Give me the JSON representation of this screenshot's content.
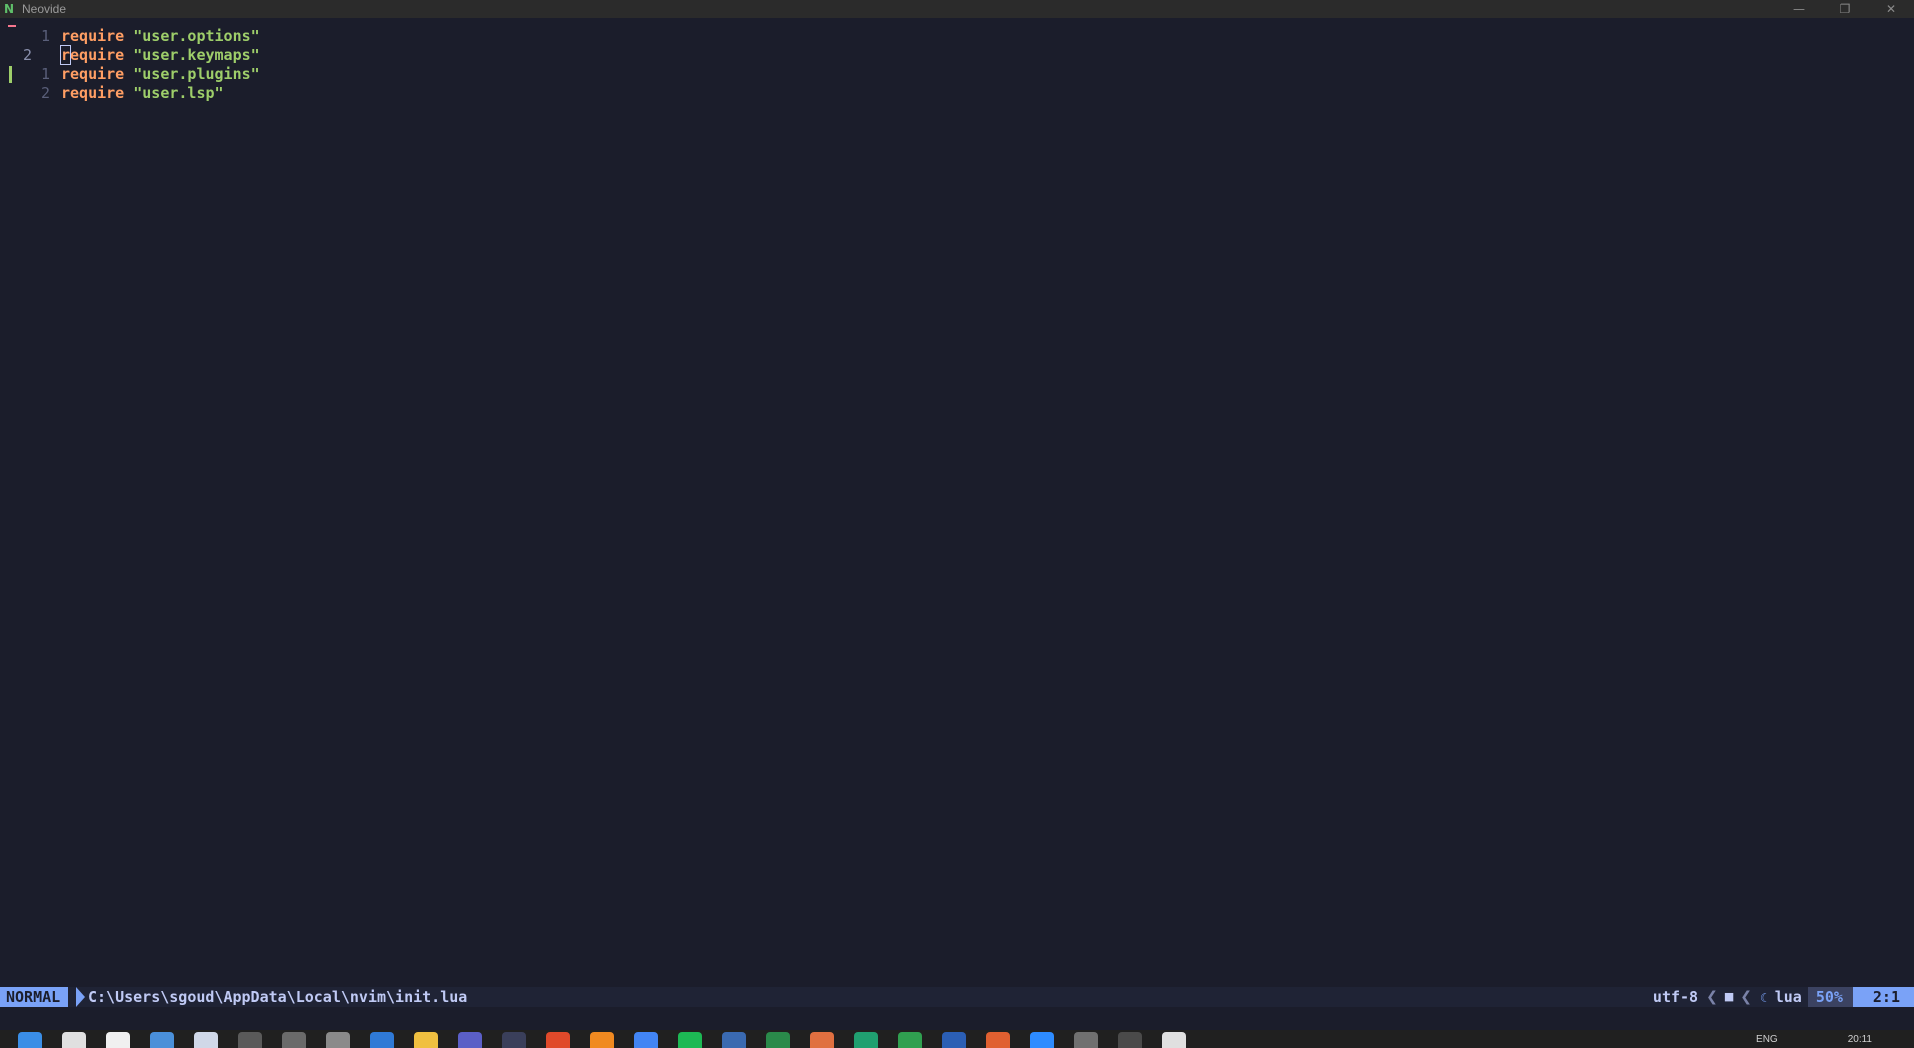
{
  "window": {
    "title": "Neovide",
    "logo_glyph": "N",
    "controls": {
      "minimize": "—",
      "maximize": "❐",
      "close": "✕"
    }
  },
  "editor": {
    "lines": [
      {
        "number": "1",
        "keyword": "require",
        "string": "\"user.options\"",
        "sign": "deleted"
      },
      {
        "number": "2",
        "keyword": "require",
        "string": "\"user.keymaps\"",
        "current": true
      },
      {
        "number": "1",
        "keyword": "require",
        "string": "\"user.plugins\"",
        "sign": "added"
      },
      {
        "number": "2",
        "keyword": "require",
        "string": "\"user.lsp\""
      }
    ]
  },
  "statusline": {
    "mode": "NORMAL",
    "filepath": "C:\\Users\\sgoud\\AppData\\Local\\nvim\\init.lua",
    "encoding": "utf-8",
    "separator": "❮",
    "os_icon": "■",
    "filetype_icon": "☾",
    "filetype": "lua",
    "progress": "50%",
    "position": "2:1"
  },
  "taskbar": {
    "language": "ENG",
    "time": "20:11",
    "icons": [
      {
        "name": "windows-start-icon",
        "color": "#3a8ee6"
      },
      {
        "name": "search-icon",
        "color": "#e0e0e0"
      },
      {
        "name": "file-icon",
        "color": "#f0f0f0"
      },
      {
        "name": "calendar-icon",
        "color": "#4a90d9"
      },
      {
        "name": "mail-icon",
        "color": "#d0d8e8"
      },
      {
        "name": "terminal-icon",
        "color": "#5a5a5a"
      },
      {
        "name": "console-icon",
        "color": "#6a6a6a"
      },
      {
        "name": "cat-icon",
        "color": "#8a8a8a"
      },
      {
        "name": "edge-icon",
        "color": "#2f7ad6"
      },
      {
        "name": "folder-icon",
        "color": "#f0c040"
      },
      {
        "name": "teams-icon",
        "color": "#5b5fc7"
      },
      {
        "name": "github-icon",
        "color": "#3a3f5a"
      },
      {
        "name": "brave-icon",
        "color": "#e04a2a"
      },
      {
        "name": "firefox-icon",
        "color": "#f08a20"
      },
      {
        "name": "chrome-icon",
        "color": "#4285f4"
      },
      {
        "name": "spotify-icon",
        "color": "#1db954"
      },
      {
        "name": "app-icon-blue",
        "color": "#3a6ab0"
      },
      {
        "name": "app-icon-green",
        "color": "#2a8a4a"
      },
      {
        "name": "app-icon-orange",
        "color": "#e07040"
      },
      {
        "name": "app-icon-teal",
        "color": "#20a070"
      },
      {
        "name": "app-icon-gear",
        "color": "#30a050"
      },
      {
        "name": "word-icon",
        "color": "#2b5fb4"
      },
      {
        "name": "app-icon-red",
        "color": "#e06030"
      },
      {
        "name": "zoom-icon",
        "color": "#2d8cff"
      },
      {
        "name": "calculator-icon",
        "color": "#707070"
      },
      {
        "name": "app-icon-dark",
        "color": "#4a4a4a"
      },
      {
        "name": "neovide-icon",
        "color": "#e0e0e0"
      }
    ]
  }
}
